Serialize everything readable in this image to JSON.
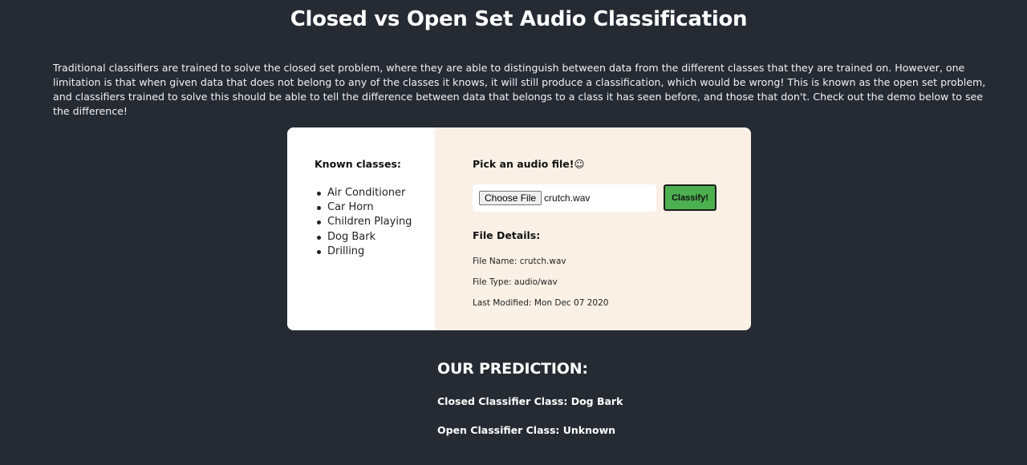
{
  "page": {
    "title": "Closed vs Open Set Audio Classification",
    "intro": "Traditional classifiers are trained to solve the closed set problem, where they are able to distinguish between data from the different classes that they are trained on. However, one limitation is that when given data that does not belong to any of the classes it knows, it will still produce a classification, which would be wrong! This is known as the open set problem, and classifiers trained to solve this should be able to tell the difference between data that belongs to a class it has seen before, and those that don't. Check out the demo below to see the difference!"
  },
  "known_classes": {
    "heading": "Known classes:",
    "items": [
      "Air Conditioner",
      "Car Horn",
      "Children Playing",
      "Dog Bark",
      "Drilling"
    ]
  },
  "upload": {
    "heading": "Pick an audio file!☺",
    "choose_label": "Choose File",
    "chosen_file": "crutch.wav",
    "classify_label": "Classify!"
  },
  "file_details": {
    "heading": "File Details:",
    "name": "File Name: crutch.wav",
    "type": "File Type: audio/wav",
    "modified": "Last Modified: Mon Dec 07 2020"
  },
  "prediction": {
    "heading": "OUR PREDICTION:",
    "closed": "Closed Classifier Class: Dog Bark",
    "open": "Open Classifier Class: Unknown"
  },
  "colors": {
    "background": "#262a33",
    "card_left": "#ffffff",
    "card_right": "#faf0e6",
    "classify_button": "#4caf50"
  }
}
